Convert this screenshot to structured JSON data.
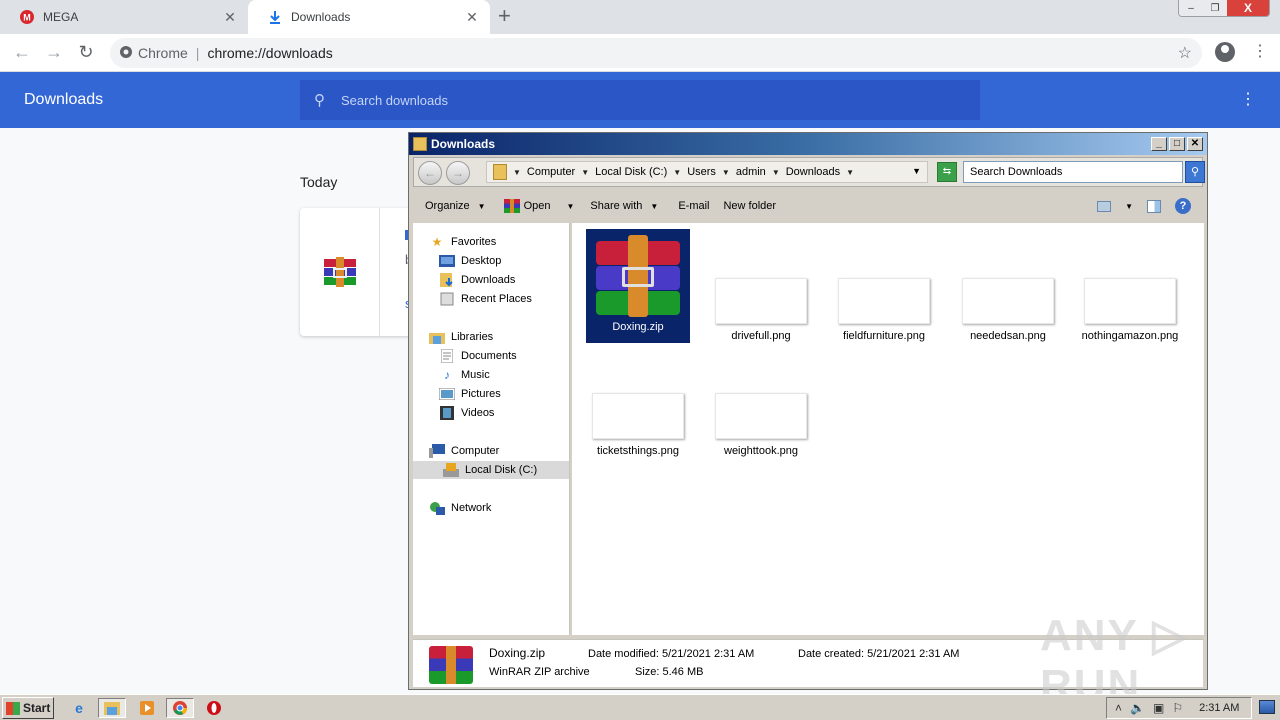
{
  "browser": {
    "tabs": [
      {
        "title": "MEGA",
        "icon": "mega-icon",
        "active": false
      },
      {
        "title": "Downloads",
        "icon": "download-icon",
        "active": true
      }
    ],
    "new_tab": "+",
    "url_site": "Chrome",
    "url": "chrome://downloads",
    "window_controls": {
      "minimize": "–",
      "restore": "❐",
      "close": "X"
    }
  },
  "downloads_page": {
    "title": "Downloads",
    "search_placeholder": "Search downloads",
    "section": "Today",
    "more": "⋮"
  },
  "explorer": {
    "title": "Downloads",
    "breadcrumb": [
      "Computer",
      "Local Disk (C:)",
      "Users",
      "admin",
      "Downloads"
    ],
    "search_placeholder": "Search Downloads",
    "commands": {
      "organize": "Organize",
      "open": "Open",
      "share_with": "Share with",
      "email": "E-mail",
      "new_folder": "New folder"
    },
    "nav": {
      "favorites": "Favorites",
      "desktop": "Desktop",
      "downloads": "Downloads",
      "recent_places": "Recent Places",
      "libraries": "Libraries",
      "documents": "Documents",
      "music": "Music",
      "pictures": "Pictures",
      "videos": "Videos",
      "computer": "Computer",
      "local_disk": "Local Disk (C:)",
      "network": "Network"
    },
    "files": [
      {
        "name": "Doxing.zip",
        "type": "rar",
        "selected": true
      },
      {
        "name": "drivefull.png",
        "type": "png"
      },
      {
        "name": "fieldfurniture.png",
        "type": "png"
      },
      {
        "name": "neededsan.png",
        "type": "png"
      },
      {
        "name": "nothingamazon.png",
        "type": "png"
      },
      {
        "name": "ticketsthings.png",
        "type": "png"
      },
      {
        "name": "weighttook.png",
        "type": "png"
      }
    ],
    "status": {
      "name": "Doxing.zip",
      "type": "WinRAR ZIP archive",
      "date_modified": "Date modified: 5/21/2021 2:31 AM",
      "date_created": "Date created: 5/21/2021 2:31 AM",
      "size": "Size: 5.46 MB"
    }
  },
  "watermark": "ANY ▷ RUN",
  "taskbar": {
    "start": "Start",
    "clock": "2:31 AM"
  }
}
